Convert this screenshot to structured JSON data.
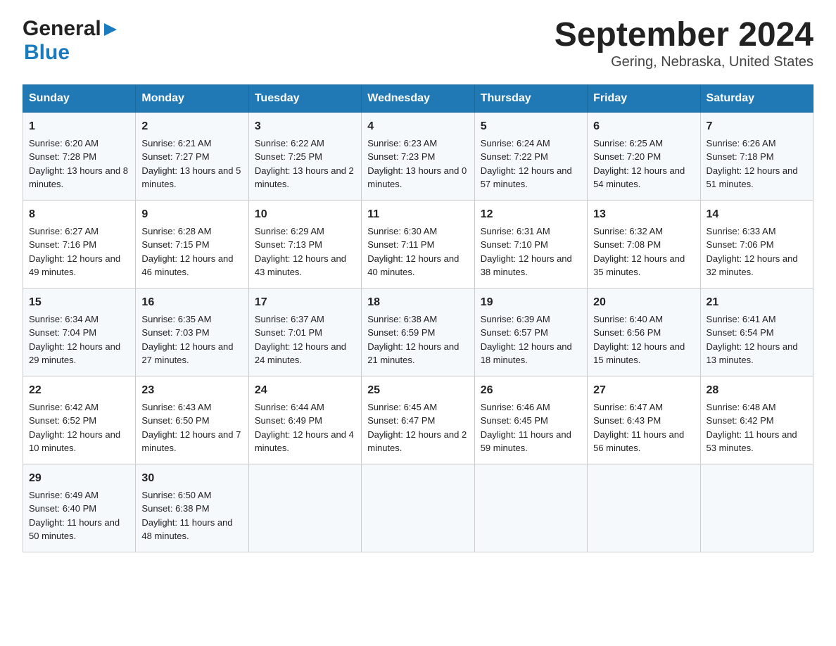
{
  "header": {
    "logo_general": "General",
    "logo_blue": "Blue",
    "title": "September 2024",
    "subtitle": "Gering, Nebraska, United States"
  },
  "days_of_week": [
    "Sunday",
    "Monday",
    "Tuesday",
    "Wednesday",
    "Thursday",
    "Friday",
    "Saturday"
  ],
  "weeks": [
    [
      {
        "day": "1",
        "sunrise": "6:20 AM",
        "sunset": "7:28 PM",
        "daylight": "13 hours and 8 minutes."
      },
      {
        "day": "2",
        "sunrise": "6:21 AM",
        "sunset": "7:27 PM",
        "daylight": "13 hours and 5 minutes."
      },
      {
        "day": "3",
        "sunrise": "6:22 AM",
        "sunset": "7:25 PM",
        "daylight": "13 hours and 2 minutes."
      },
      {
        "day": "4",
        "sunrise": "6:23 AM",
        "sunset": "7:23 PM",
        "daylight": "13 hours and 0 minutes."
      },
      {
        "day": "5",
        "sunrise": "6:24 AM",
        "sunset": "7:22 PM",
        "daylight": "12 hours and 57 minutes."
      },
      {
        "day": "6",
        "sunrise": "6:25 AM",
        "sunset": "7:20 PM",
        "daylight": "12 hours and 54 minutes."
      },
      {
        "day": "7",
        "sunrise": "6:26 AM",
        "sunset": "7:18 PM",
        "daylight": "12 hours and 51 minutes."
      }
    ],
    [
      {
        "day": "8",
        "sunrise": "6:27 AM",
        "sunset": "7:16 PM",
        "daylight": "12 hours and 49 minutes."
      },
      {
        "day": "9",
        "sunrise": "6:28 AM",
        "sunset": "7:15 PM",
        "daylight": "12 hours and 46 minutes."
      },
      {
        "day": "10",
        "sunrise": "6:29 AM",
        "sunset": "7:13 PM",
        "daylight": "12 hours and 43 minutes."
      },
      {
        "day": "11",
        "sunrise": "6:30 AM",
        "sunset": "7:11 PM",
        "daylight": "12 hours and 40 minutes."
      },
      {
        "day": "12",
        "sunrise": "6:31 AM",
        "sunset": "7:10 PM",
        "daylight": "12 hours and 38 minutes."
      },
      {
        "day": "13",
        "sunrise": "6:32 AM",
        "sunset": "7:08 PM",
        "daylight": "12 hours and 35 minutes."
      },
      {
        "day": "14",
        "sunrise": "6:33 AM",
        "sunset": "7:06 PM",
        "daylight": "12 hours and 32 minutes."
      }
    ],
    [
      {
        "day": "15",
        "sunrise": "6:34 AM",
        "sunset": "7:04 PM",
        "daylight": "12 hours and 29 minutes."
      },
      {
        "day": "16",
        "sunrise": "6:35 AM",
        "sunset": "7:03 PM",
        "daylight": "12 hours and 27 minutes."
      },
      {
        "day": "17",
        "sunrise": "6:37 AM",
        "sunset": "7:01 PM",
        "daylight": "12 hours and 24 minutes."
      },
      {
        "day": "18",
        "sunrise": "6:38 AM",
        "sunset": "6:59 PM",
        "daylight": "12 hours and 21 minutes."
      },
      {
        "day": "19",
        "sunrise": "6:39 AM",
        "sunset": "6:57 PM",
        "daylight": "12 hours and 18 minutes."
      },
      {
        "day": "20",
        "sunrise": "6:40 AM",
        "sunset": "6:56 PM",
        "daylight": "12 hours and 15 minutes."
      },
      {
        "day": "21",
        "sunrise": "6:41 AM",
        "sunset": "6:54 PM",
        "daylight": "12 hours and 13 minutes."
      }
    ],
    [
      {
        "day": "22",
        "sunrise": "6:42 AM",
        "sunset": "6:52 PM",
        "daylight": "12 hours and 10 minutes."
      },
      {
        "day": "23",
        "sunrise": "6:43 AM",
        "sunset": "6:50 PM",
        "daylight": "12 hours and 7 minutes."
      },
      {
        "day": "24",
        "sunrise": "6:44 AM",
        "sunset": "6:49 PM",
        "daylight": "12 hours and 4 minutes."
      },
      {
        "day": "25",
        "sunrise": "6:45 AM",
        "sunset": "6:47 PM",
        "daylight": "12 hours and 2 minutes."
      },
      {
        "day": "26",
        "sunrise": "6:46 AM",
        "sunset": "6:45 PM",
        "daylight": "11 hours and 59 minutes."
      },
      {
        "day": "27",
        "sunrise": "6:47 AM",
        "sunset": "6:43 PM",
        "daylight": "11 hours and 56 minutes."
      },
      {
        "day": "28",
        "sunrise": "6:48 AM",
        "sunset": "6:42 PM",
        "daylight": "11 hours and 53 minutes."
      }
    ],
    [
      {
        "day": "29",
        "sunrise": "6:49 AM",
        "sunset": "6:40 PM",
        "daylight": "11 hours and 50 minutes."
      },
      {
        "day": "30",
        "sunrise": "6:50 AM",
        "sunset": "6:38 PM",
        "daylight": "11 hours and 48 minutes."
      },
      {
        "day": "",
        "sunrise": "",
        "sunset": "",
        "daylight": ""
      },
      {
        "day": "",
        "sunrise": "",
        "sunset": "",
        "daylight": ""
      },
      {
        "day": "",
        "sunrise": "",
        "sunset": "",
        "daylight": ""
      },
      {
        "day": "",
        "sunrise": "",
        "sunset": "",
        "daylight": ""
      },
      {
        "day": "",
        "sunrise": "",
        "sunset": "",
        "daylight": ""
      }
    ]
  ]
}
